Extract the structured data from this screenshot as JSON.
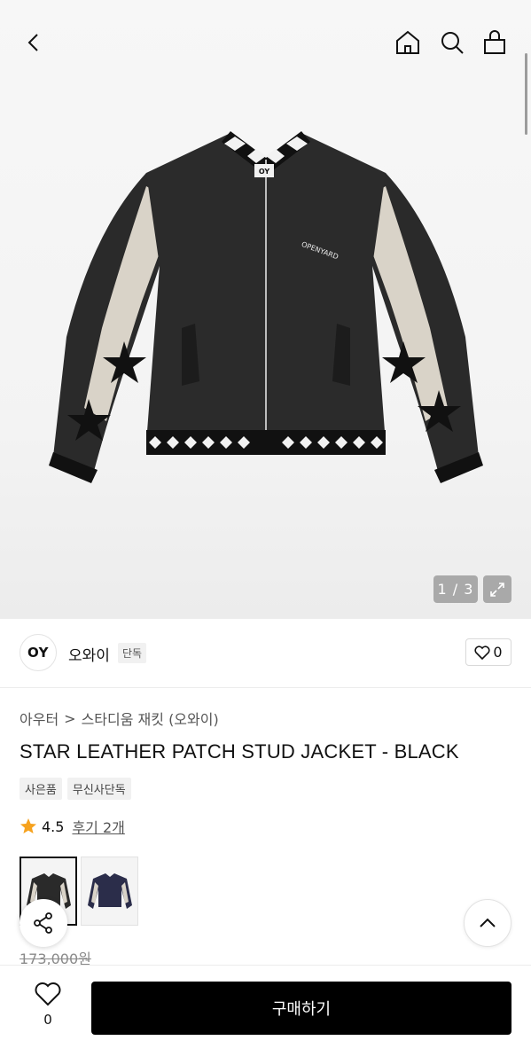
{
  "header": {
    "back_icon": "chevron-left-icon",
    "home_icon": "home-icon",
    "search_icon": "search-icon",
    "bag_icon": "shopping-bag-icon"
  },
  "gallery": {
    "counter": "1 / 3",
    "jacket_logo": "OY",
    "jacket_embroidery": "OPENYARD"
  },
  "brand": {
    "logo_text": "OY",
    "name": "오와이",
    "badge": "단독",
    "like_count": "0"
  },
  "breadcrumb": {
    "category": "아우터",
    "separator": ">",
    "subcategory": "스타디움 재킷 (오와이)"
  },
  "product": {
    "title": "STAR LEATHER PATCH STUD JACKET - BLACK",
    "tags": [
      "사은품",
      "무신사단독"
    ],
    "rating": "4.5",
    "review_link": "후기 2개",
    "original_price": "173,000원"
  },
  "colors": {
    "black": "#2a2a2a",
    "navy": "#2b2d4a",
    "beige": "#d9d3c8",
    "star": "#f6a21e"
  },
  "bottom_bar": {
    "wish_count": "0",
    "buy_label": "구매하기"
  }
}
